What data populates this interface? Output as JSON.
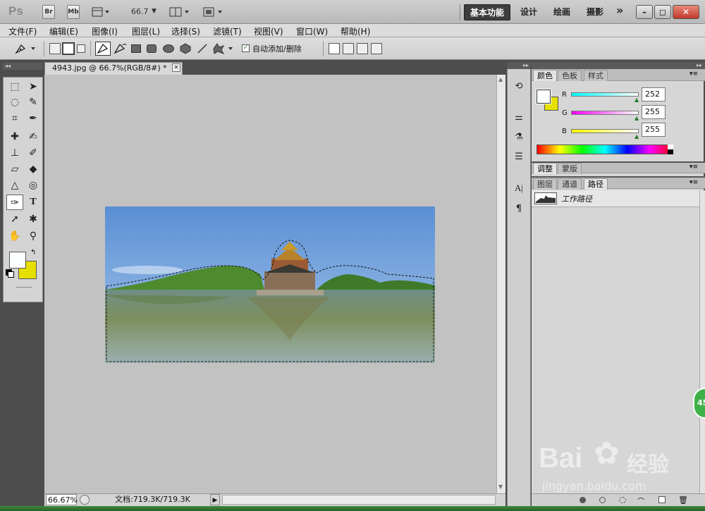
{
  "app": {
    "logo": "Ps",
    "bridge_btn": "Br",
    "minibridge_btn": "Mb",
    "zoom_field": "66.7"
  },
  "workspaces": [
    "基本功能",
    "设计",
    "绘画",
    "摄影"
  ],
  "workspace_more": "»",
  "window_controls": {
    "minimize": "–",
    "restore": "◻",
    "close": "✕"
  },
  "menus": [
    "文件(F)",
    "编辑(E)",
    "图像(I)",
    "图层(L)",
    "选择(S)",
    "滤镜(T)",
    "视图(V)",
    "窗口(W)",
    "帮助(H)"
  ],
  "options": {
    "auto_add_delete": "自动添加/删除",
    "auto_add_checked": true
  },
  "document": {
    "tab_title": "4943.jpg @ 66.7%(RGB/8#) *",
    "close_glyph": "✕",
    "zoom": "66.67%",
    "doc_size": "文档:719.3K/719.3K"
  },
  "colors": {
    "foreground": "#fcffff",
    "background": "#e6e000",
    "accent_dark": "#3d3d3d"
  },
  "color_panel": {
    "tabs": [
      "颜色",
      "色板",
      "样式"
    ],
    "active_tab": "颜色",
    "channels": [
      {
        "label": "R",
        "value": "252"
      },
      {
        "label": "G",
        "value": "255"
      },
      {
        "label": "B",
        "value": "255"
      }
    ]
  },
  "adjust_panel": {
    "tabs": [
      "调整",
      "蒙版"
    ]
  },
  "layers_panel": {
    "tabs": [
      "图层",
      "通道",
      "路径"
    ],
    "active_tab": "路径",
    "path_name": "工作路径"
  },
  "watermark": {
    "brand": "Bai",
    "brand2": "经验",
    "url": "jingyan.baidu.com"
  },
  "side_badge": "45"
}
